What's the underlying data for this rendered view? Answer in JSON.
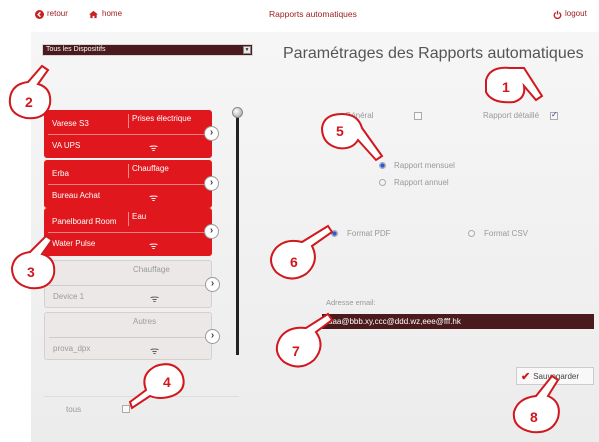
{
  "topbar": {
    "back_label": "retour",
    "home_label": "home",
    "title": "Rapports automatiques",
    "logout_label": "logout"
  },
  "device_filter": {
    "selected": "Tous les Dispositifs"
  },
  "page_heading": "Paramétrages des Rapports automatiques",
  "devices": [
    {
      "name": "Varese S3",
      "subname": "VA UPS",
      "type": "Prises électrique",
      "active": true
    },
    {
      "name": "Erba",
      "subname": "Bureau Achat",
      "type": "Chauffage",
      "active": true
    },
    {
      "name": "Panelboard Room",
      "subname": "Water Pulse",
      "type": "Eau",
      "active": true
    },
    {
      "name": "",
      "subname": "Device 1",
      "type": "Chauffage",
      "active": false
    },
    {
      "name": "",
      "subname": "prova_dpx",
      "type": "Autres",
      "active": false
    }
  ],
  "select_all_label": "tous",
  "report_options": {
    "general_label": "Général",
    "general_checked": false,
    "detailed_label": "Rapport détaillé",
    "detailed_checked": true,
    "monthly_label": "Rapport mensuel",
    "annual_label": "Rapport annuel",
    "period_selected": "monthly",
    "pdf_label": "Format PDF",
    "csv_label": "Format CSV",
    "format_selected": "pdf"
  },
  "email": {
    "label": "Adresse email:",
    "value": "aaa@bbb.xy,ccc@ddd.wz,eee@fff.hk"
  },
  "save_label": "Sauvegarder",
  "callouts": [
    "1",
    "2",
    "3",
    "4",
    "5",
    "6",
    "7",
    "8"
  ],
  "colors": {
    "accent_red": "#e0171c",
    "dark_field": "#4a1a1d",
    "title_red": "#9b1b1b"
  }
}
